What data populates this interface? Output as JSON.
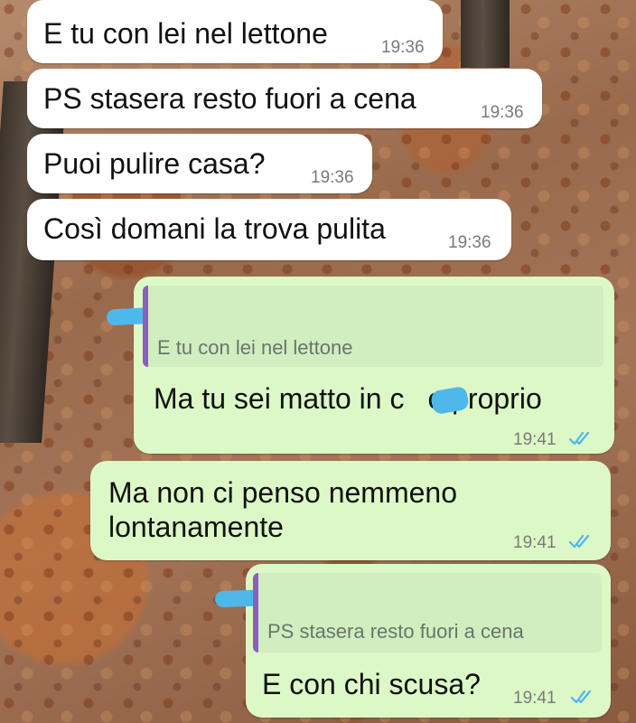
{
  "messages": {
    "m1": {
      "text": "E tu con lei nel lettone",
      "time": "19:36"
    },
    "m2": {
      "text": "PS stasera resto fuori a cena",
      "time": "19:36"
    },
    "m3": {
      "text": "Puoi pulire casa?",
      "time": "19:36"
    },
    "m4": {
      "text": "Così domani la trova pulita",
      "time": "19:36"
    },
    "m5": {
      "quote": "E tu con lei nel lettone",
      "text_start": "Ma tu sei matto in c",
      "text_end": "o proprio",
      "time": "19:41"
    },
    "m6": {
      "line1": "Ma non ci penso nemmeno",
      "line2": "lontanamente",
      "time": "19:41"
    },
    "m7": {
      "quote": "PS stasera resto fuori a cena",
      "text": "E con chi scusa?",
      "time": "19:41"
    }
  },
  "colors": {
    "incoming_bubble": "#ffffff",
    "outgoing_bubble": "#dcf8c6",
    "read_ticks": "#4fb6ec",
    "quote_bar": "#8b5ec4",
    "redaction": "#4fb8ea"
  },
  "icons": {
    "read_status": "double-check-icon"
  }
}
